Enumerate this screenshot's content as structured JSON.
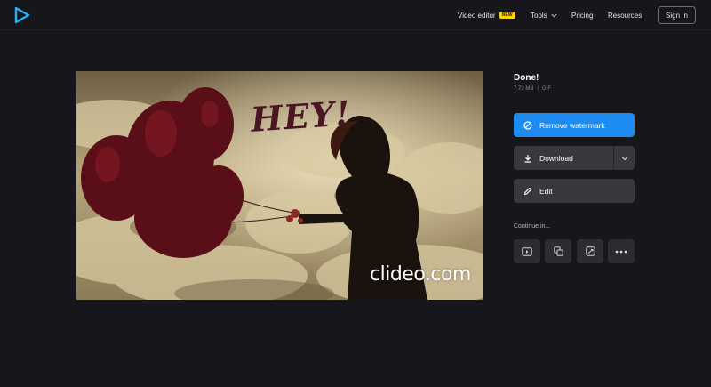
{
  "header": {
    "logo_icon": "clideo-play-logo-icon",
    "nav": [
      {
        "label": "Video editor",
        "badge": "NEW"
      },
      {
        "label": "Tools"
      },
      {
        "label": "Pricing"
      },
      {
        "label": "Resources"
      }
    ],
    "sign_in": "Sign In"
  },
  "preview": {
    "caption": "HEY!",
    "watermark": "clideo.com"
  },
  "result": {
    "title": "Done!",
    "size": "7.73 MB",
    "separator": "/",
    "format": "GIF"
  },
  "actions": {
    "remove_watermark": "Remove watermark",
    "download": "Download",
    "edit": "Edit"
  },
  "continue": {
    "label": "Continue in...",
    "icons": [
      "video-play-icon",
      "copy-layers-icon",
      "loop-icon",
      "more-dots-icon"
    ]
  },
  "colors": {
    "background": "#16161b",
    "accent": "#1d8bf1",
    "badge": "#ffd400",
    "button": "#38383e"
  }
}
